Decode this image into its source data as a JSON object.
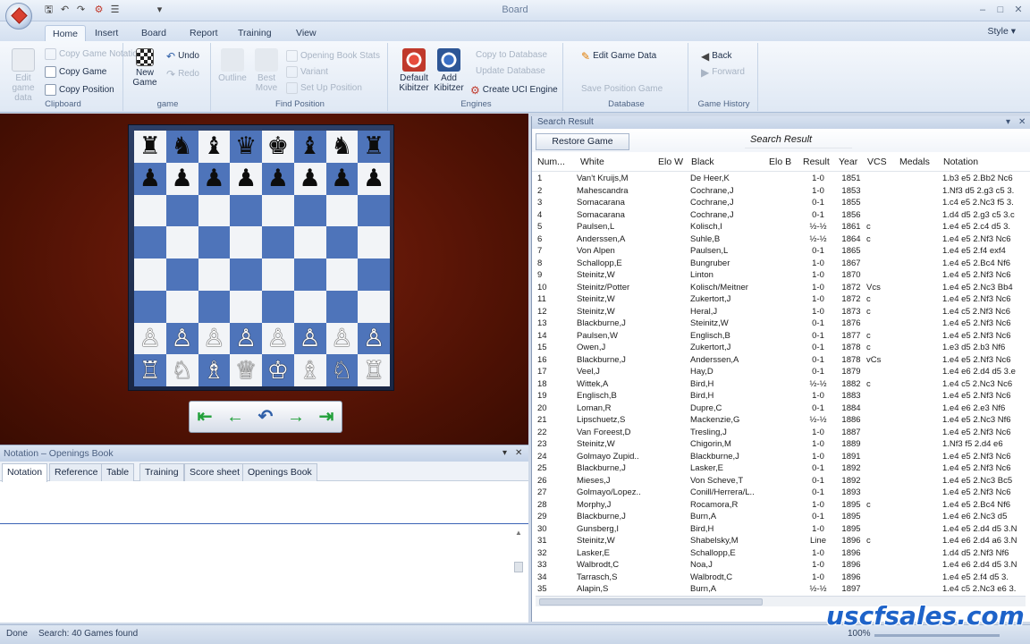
{
  "window": {
    "title": "Board"
  },
  "ribbon_tabs": [
    "Home",
    "Insert",
    "Board",
    "Report",
    "Training",
    "View"
  ],
  "style_menu": "Style",
  "ribbon": {
    "clipboard": {
      "label": "Clipboard",
      "copy_game_notation": "Copy Game Notation",
      "copy_game": "Copy Game",
      "copy_position": "Copy Position",
      "edit_game_data_small": "Edit game data"
    },
    "game": {
      "label": "game",
      "new_game": "New Game",
      "undo": "Undo",
      "redo": "Redo"
    },
    "find_position": {
      "label": "Find Position",
      "outline": "Outline",
      "best_move": "Best Move",
      "opening_book_stats": "Opening Book Stats",
      "variant": "Variant",
      "set_up_position": "Set Up Position"
    },
    "engines": {
      "label": "Engines",
      "default_kibitzer": "Default Kibitzer",
      "add_kibitzer": "Add Kibitzer",
      "create_uci_engine": "Create UCI Engine"
    },
    "database": {
      "label": "Database",
      "edit_game_data": "Edit Game Data",
      "copy_to_database": "Copy to Database",
      "update_database": "Update Database",
      "save_position_game": "Save Position Game"
    },
    "game_history": {
      "label": "Game History",
      "back": "Back",
      "forward": "Forward"
    }
  },
  "board": {
    "squares": [
      [
        "♜",
        "♞",
        "♝",
        "♛",
        "♚",
        "♝",
        "♞",
        "♜"
      ],
      [
        "♟",
        "♟",
        "♟",
        "♟",
        "♟",
        "♟",
        "♟",
        "♟"
      ],
      [
        "",
        "",
        "",
        "",
        "",
        "",
        "",
        ""
      ],
      [
        "",
        "",
        "",
        "",
        "",
        "",
        "",
        ""
      ],
      [
        "",
        "",
        "",
        "",
        "",
        "",
        "",
        ""
      ],
      [
        "",
        "",
        "",
        "",
        "",
        "",
        "",
        ""
      ],
      [
        "♙",
        "♙",
        "♙",
        "♙",
        "♙",
        "♙",
        "♙",
        "♙"
      ],
      [
        "♖",
        "♘",
        "♗",
        "♕",
        "♔",
        "♗",
        "♘",
        "♖"
      ]
    ]
  },
  "notation_panel": {
    "header": "Notation – Openings Book",
    "tabs": [
      "Notation",
      "Reference",
      "Table",
      "Training",
      "Score sheet",
      "Openings Book"
    ]
  },
  "search_panel": {
    "header": "Search Result",
    "restore_button": "Restore Game",
    "title": "Search Result",
    "columns": [
      "Num...",
      "White",
      "Elo W",
      "Black",
      "Elo B",
      "Result",
      "Year",
      "VCS",
      "Medals",
      "Notation"
    ],
    "rows": [
      [
        "1",
        "Van't Kruijs,M",
        "",
        "De Heer,K",
        "",
        "1-0",
        "1851",
        "",
        "",
        "1.b3 e5 2.Bb2 Nc6"
      ],
      [
        "2",
        "Mahescandra",
        "",
        "Cochrane,J",
        "",
        "1-0",
        "1853",
        "",
        "",
        "1.Nf3 d5 2.g3 c5 3."
      ],
      [
        "3",
        "Somacarana",
        "",
        "Cochrane,J",
        "",
        "0-1",
        "1855",
        "",
        "",
        "1.c4 e5 2.Nc3 f5 3."
      ],
      [
        "4",
        "Somacarana",
        "",
        "Cochrane,J",
        "",
        "0-1",
        "1856",
        "",
        "",
        "1.d4 d5 2.g3 c5 3.c"
      ],
      [
        "5",
        "Paulsen,L",
        "",
        "Kolisch,I",
        "",
        "½-½",
        "1861",
        "c",
        "",
        "1.e4 e5 2.c4 d5 3."
      ],
      [
        "6",
        "Anderssen,A",
        "",
        "Suhle,B",
        "",
        "½-½",
        "1864",
        "c",
        "",
        "1.e4 e5 2.Nf3 Nc6"
      ],
      [
        "7",
        "Von Alpen",
        "",
        "Paulsen,L",
        "",
        "0-1",
        "1865",
        "",
        "",
        "1.e4 e5 2.f4 exf4"
      ],
      [
        "8",
        "Schallopp,E",
        "",
        "Bungruber",
        "",
        "1-0",
        "1867",
        "",
        "",
        "1.e4 e5 2.Bc4 Nf6"
      ],
      [
        "9",
        "Steinitz,W",
        "",
        "Linton",
        "",
        "1-0",
        "1870",
        "",
        "",
        "1.e4 e5 2.Nf3 Nc6"
      ],
      [
        "10",
        "Steinitz/Potter",
        "",
        "Kolisch/Meitner",
        "",
        "1-0",
        "1872",
        "Vcs",
        "",
        "1.e4 e5 2.Nc3 Bb4"
      ],
      [
        "11",
        "Steinitz,W",
        "",
        "Zukertort,J",
        "",
        "1-0",
        "1872",
        "c",
        "",
        "1.e4 e5 2.Nf3 Nc6"
      ],
      [
        "12",
        "Steinitz,W",
        "",
        "Heral,J",
        "",
        "1-0",
        "1873",
        "c",
        "",
        "1.e4 c5 2.Nf3 Nc6"
      ],
      [
        "13",
        "Blackburne,J",
        "",
        "Steinitz,W",
        "",
        "0-1",
        "1876",
        "",
        "",
        "1.e4 e5 2.Nf3 Nc6"
      ],
      [
        "14",
        "Paulsen,W",
        "",
        "Englisch,B",
        "",
        "0-1",
        "1877",
        "c",
        "",
        "1.e4 e5 2.Nf3 Nc6"
      ],
      [
        "15",
        "Owen,J",
        "",
        "Zukertort,J",
        "",
        "0-1",
        "1878",
        "c",
        "",
        "1.e3 d5 2.b3 Nf6"
      ],
      [
        "16",
        "Blackburne,J",
        "",
        "Anderssen,A",
        "",
        "0-1",
        "1878",
        "vCs",
        "",
        "1.e4 e5 2.Nf3 Nc6"
      ],
      [
        "17",
        "Veel,J",
        "",
        "Hay,D",
        "",
        "0-1",
        "1879",
        "",
        "",
        "1.e4 e6 2.d4 d5 3.e"
      ],
      [
        "18",
        "Wittek,A",
        "",
        "Bird,H",
        "",
        "½-½",
        "1882",
        "c",
        "",
        "1.e4 c5 2.Nc3 Nc6"
      ],
      [
        "19",
        "Englisch,B",
        "",
        "Bird,H",
        "",
        "1-0",
        "1883",
        "",
        "",
        "1.e4 e5 2.Nf3 Nc6"
      ],
      [
        "20",
        "Loman,R",
        "",
        "Dupre,C",
        "",
        "0-1",
        "1884",
        "",
        "",
        "1.e4 e6 2.e3 Nf6"
      ],
      [
        "21",
        "Lipschuetz,S",
        "",
        "Mackenzie,G",
        "",
        "½-½",
        "1886",
        "",
        "",
        "1.e4 e5 2.Nc3 Nf6"
      ],
      [
        "22",
        "Van Foreest,D",
        "",
        "Tresling,J",
        "",
        "1-0",
        "1887",
        "",
        "",
        "1.e4 e5 2.Nf3 Nc6"
      ],
      [
        "23",
        "Steinitz,W",
        "",
        "Chigorin,M",
        "",
        "1-0",
        "1889",
        "",
        "",
        "1.Nf3 f5 2.d4 e6"
      ],
      [
        "24",
        "Golmayo Zupid..",
        "",
        "Blackburne,J",
        "",
        "1-0",
        "1891",
        "",
        "",
        "1.e4 e5 2.Nf3 Nc6"
      ],
      [
        "25",
        "Blackburne,J",
        "",
        "Lasker,E",
        "",
        "0-1",
        "1892",
        "",
        "",
        "1.e4 e5 2.Nf3 Nc6"
      ],
      [
        "26",
        "Mieses,J",
        "",
        "Von Scheve,T",
        "",
        "0-1",
        "1892",
        "",
        "",
        "1.e4 e5 2.Nc3 Bc5"
      ],
      [
        "27",
        "Golmayo/Lopez..",
        "",
        "Conill/Herrera/L..",
        "",
        "0-1",
        "1893",
        "",
        "",
        "1.e4 e5 2.Nf3 Nc6"
      ],
      [
        "28",
        "Morphy,J",
        "",
        "Rocamora,R",
        "",
        "1-0",
        "1895",
        "c",
        "",
        "1.e4 e5 2.Bc4 Nf6"
      ],
      [
        "29",
        "Blackburne,J",
        "",
        "Burn,A",
        "",
        "0-1",
        "1895",
        "",
        "",
        "1.e4 e6 2.Nc3 d5"
      ],
      [
        "30",
        "Gunsberg,I",
        "",
        "Bird,H",
        "",
        "1-0",
        "1895",
        "",
        "",
        "1.e4 e5 2.d4 d5 3.N"
      ],
      [
        "31",
        "Steinitz,W",
        "",
        "Shabelsky,M",
        "",
        "Line",
        "1896",
        "c",
        "",
        "1.e4 e6 2.d4 a6 3.N"
      ],
      [
        "32",
        "Lasker,E",
        "",
        "Schallopp,E",
        "",
        "1-0",
        "1896",
        "",
        "",
        "1.d4 d5 2.Nf3 Nf6"
      ],
      [
        "33",
        "Walbrodt,C",
        "",
        "Noa,J",
        "",
        "1-0",
        "1896",
        "",
        "",
        "1.e4 e6 2.d4 d5 3.N"
      ],
      [
        "34",
        "Tarrasch,S",
        "",
        "Walbrodt,C",
        "",
        "1-0",
        "1896",
        "",
        "",
        "1.e4 e5 2.f4 d5 3."
      ],
      [
        "35",
        "Alapin,S",
        "",
        "Burn,A",
        "",
        "½-½",
        "1897",
        "",
        "",
        "1.e4 c5 2.Nc3 e6 3."
      ]
    ]
  },
  "status": {
    "done": "Done",
    "search": "Search: 40 Games found",
    "zoom": "100%"
  },
  "watermark": "uscfsales.com"
}
